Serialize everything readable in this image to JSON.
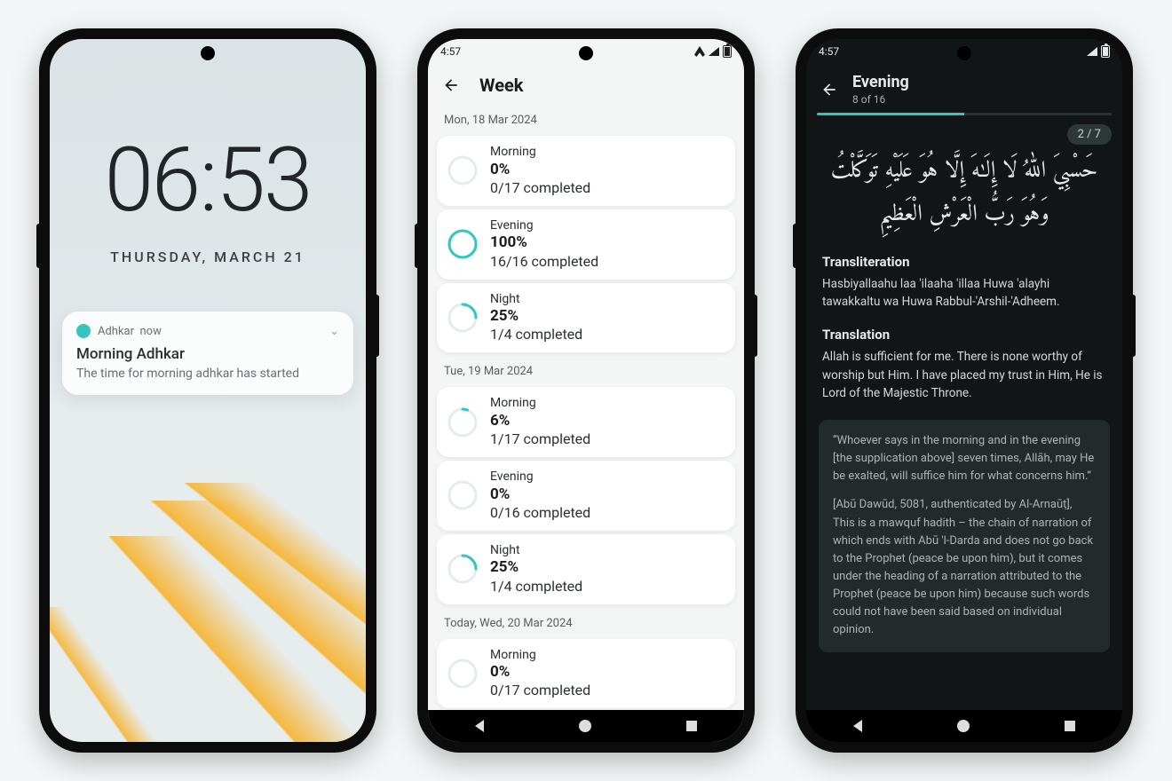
{
  "phone1": {
    "clock": "06:53",
    "date": "THURSDAY, MARCH 21",
    "notification": {
      "app": "Adhkar",
      "when": "now",
      "title": "Morning Adhkar",
      "body": "The time for morning adhkar has started"
    }
  },
  "phone2": {
    "status_time": "4:57",
    "title": "Week",
    "days": [
      {
        "label": "Mon, 18 Mar 2024",
        "rows": [
          {
            "name": "Morning",
            "pct": 0,
            "pct_label": "0%",
            "count": "0/17 completed"
          },
          {
            "name": "Evening",
            "pct": 100,
            "pct_label": "100%",
            "count": "16/16 completed"
          },
          {
            "name": "Night",
            "pct": 25,
            "pct_label": "25%",
            "count": "1/4 completed"
          }
        ]
      },
      {
        "label": "Tue, 19 Mar 2024",
        "rows": [
          {
            "name": "Morning",
            "pct": 6,
            "pct_label": "6%",
            "count": "1/17 completed"
          },
          {
            "name": "Evening",
            "pct": 0,
            "pct_label": "0%",
            "count": "0/16 completed"
          },
          {
            "name": "Night",
            "pct": 25,
            "pct_label": "25%",
            "count": "1/4 completed"
          }
        ]
      },
      {
        "label": "Today, Wed, 20 Mar 2024",
        "rows": [
          {
            "name": "Morning",
            "pct": 0,
            "pct_label": "0%",
            "count": "0/17 completed"
          }
        ]
      }
    ]
  },
  "phone3": {
    "status_time": "4:57",
    "title": "Evening",
    "subtitle": "8 of 16",
    "progress_pct": 50,
    "counter": "2 / 7",
    "arabic": "حَسْبِيَ اللّٰهُ لَا إِلَـٰهَ إِلَّا هُوَ عَلَيْهِ تَوَكَّلْتُ وَهُوَ رَبُّ الْعَرْشِ الْعَظِيمِ",
    "translit_h": "Transliteration",
    "transliteration": "Hasbiyallaahu laa 'ilaaha 'illaa Huwa 'alayhi tawakkaltu wa Huwa Rabbul-'Arshil-'Adheem.",
    "transl_h": "Translation",
    "translation": "Allah is sufficient for me. There is none worthy of worship but Him. I have placed my trust in Him, He is Lord of the Majestic Throne.",
    "note1": "“Whoever says in the morning and in the evening [the supplication above] seven times, Allāh, may He be exalted, will suffice him for what concerns him.”",
    "note2": "[Abū Dawūd, 5081, authenticated by Al-Arnaūṭ], This is a mawquf hadith – the chain of narration of which ends with Abū 'l-Darda and does not go back to the Prophet (peace be upon him), but it comes under the heading of a narration attributed to the Prophet (peace be upon him) because such words could not have been said based on individual opinion."
  },
  "colors": {
    "teal": "#35c5c0"
  }
}
